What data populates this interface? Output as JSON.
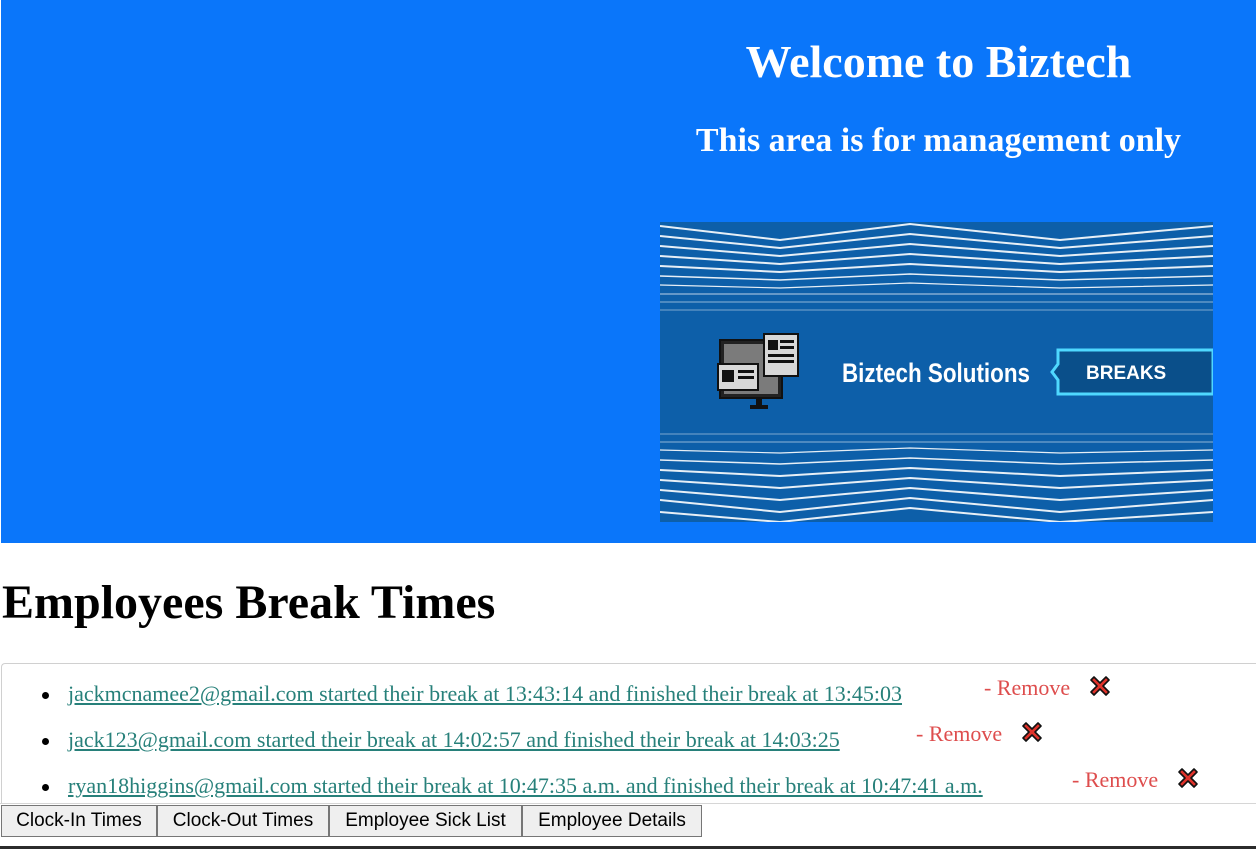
{
  "header": {
    "title": "Welcome to Biztech",
    "subtitle": "This area is for management only",
    "background_color": "#0a76fa"
  },
  "banner": {
    "company_name": "Biztech Solutions",
    "badge_label": "BREAKS",
    "icon": "computer-monitor-icon"
  },
  "main": {
    "heading": "Employees Break Times",
    "entries": [
      {
        "text": "jackmcnamee2@gmail.com started their break at 13:43:14 and finished their break at 13:45:03",
        "remove_label": "- Remove"
      },
      {
        "text": "jack123@gmail.com started their break at 14:02:57 and finished their break at 14:03:25",
        "remove_label": "- Remove"
      },
      {
        "text": "ryan18higgins@gmail.com started their break at 10:47:35 a.m. and finished their break at 10:47:41 a.m.",
        "remove_label": "- Remove"
      }
    ],
    "remove_icon": "red-x-icon",
    "link_color": "#27807a",
    "remove_color": "#de4d4d"
  },
  "nav": {
    "buttons": [
      "Clock-In Times",
      "Clock-Out Times",
      "Employee Sick List",
      "Employee Details"
    ]
  }
}
